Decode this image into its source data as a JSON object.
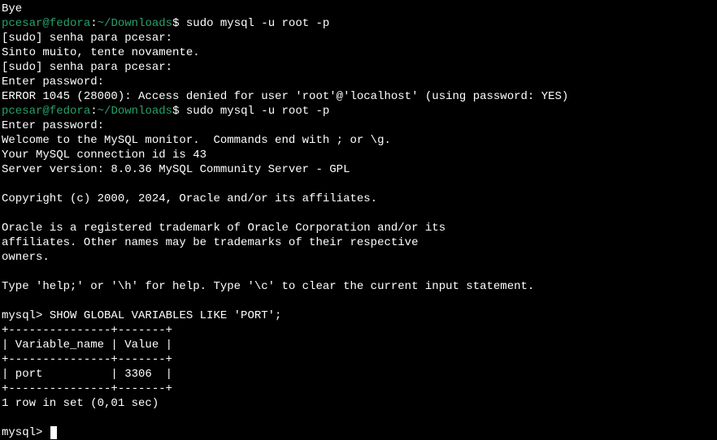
{
  "lines": {
    "bye": "Bye",
    "sudo1": "[sudo] senha para pcesar: ",
    "retry": "Sinto muito, tente novamente.",
    "sudo2": "[sudo] senha para pcesar: ",
    "enterpw1": "Enter password: ",
    "error": "ERROR 1045 (28000): Access denied for user 'root'@'localhost' (using password: YES)",
    "enterpw2": "Enter password: ",
    "welcome": "Welcome to the MySQL monitor.  Commands end with ; or \\g.",
    "connid": "Your MySQL connection id is 43",
    "version": "Server version: 8.0.36 MySQL Community Server - GPL",
    "copyright": "Copyright (c) 2000, 2024, Oracle and/or its affiliates.",
    "tm1": "Oracle is a registered trademark of Oracle Corporation and/or its",
    "tm2": "affiliates. Other names may be trademarks of their respective",
    "tm3": "owners.",
    "help": "Type 'help;' or '\\h' for help. Type '\\c' to clear the current input statement.",
    "tborder": "+---------------+-------+",
    "theader": "| Variable_name | Value |",
    "trow": "| port          | 3306  |",
    "rowcount": "1 row in set (0,01 sec)",
    "blank": ""
  },
  "prompt1": {
    "user": "pcesar",
    "at": "@",
    "host": "fedora",
    "colon": ":",
    "path": "~/Downloads",
    "dollar": "$ ",
    "command": "sudo mysql -u root -p"
  },
  "prompt2": {
    "user": "pcesar",
    "at": "@",
    "host": "fedora",
    "colon": ":",
    "path": "~/Downloads",
    "dollar": "$ ",
    "command": "sudo mysql -u root -p"
  },
  "mysql1": {
    "prompt": "mysql> ",
    "command": "SHOW GLOBAL VARIABLES LIKE 'PORT';"
  },
  "mysql2": {
    "prompt": "mysql> "
  }
}
